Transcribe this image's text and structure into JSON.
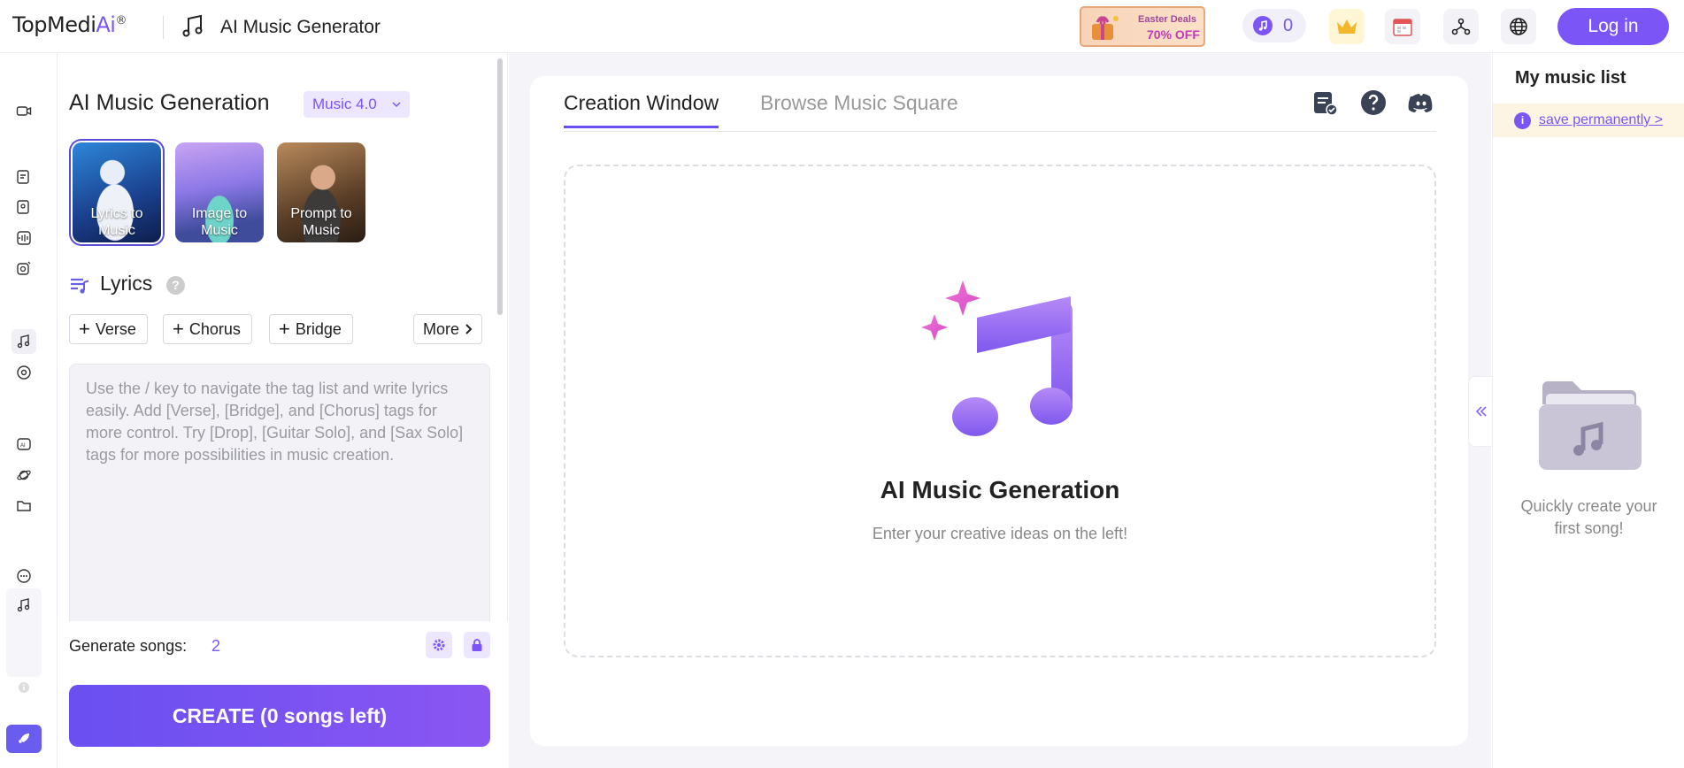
{
  "header": {
    "logo_main": "TopMedi",
    "logo_accent": "Ai",
    "logo_reg": "®",
    "app_title": "AI Music Generator",
    "promo_line1": "Easter Deals",
    "promo_line2": "70% OFF",
    "credits": "0",
    "login_label": "Log in"
  },
  "left_panel": {
    "title": "AI Music Generation",
    "model_badge": "Music 4.0",
    "modes": [
      {
        "label": "Lyrics to Music"
      },
      {
        "label": "Image to Music"
      },
      {
        "label": "Prompt to Music"
      }
    ],
    "lyrics_title": "Lyrics",
    "lyrics_help": "?",
    "tag_buttons": [
      {
        "label": "Verse"
      },
      {
        "label": "Chorus"
      },
      {
        "label": "Bridge"
      }
    ],
    "more_label": "More",
    "lyrics_placeholder": "Use the / key to navigate the tag list and write lyrics easily. Add [Verse], [Bridge], and [Chorus] tags for more control. Try [Drop], [Guitar Solo], and [Sax Solo] tags for more possibilities in music creation.",
    "generate_label": "Generate songs:",
    "generate_value": "2",
    "create_label": "CREATE (0 songs left)"
  },
  "center": {
    "tabs": [
      {
        "label": "Creation Window"
      },
      {
        "label": "Browse Music Square"
      }
    ],
    "empty_title": "AI Music Generation",
    "empty_subtitle": "Enter your creative ideas on the left!"
  },
  "right_panel": {
    "title": "My music list",
    "save_info": "i",
    "save_link": "save permanently >",
    "empty_text": "Quickly create your first song!"
  },
  "colors": {
    "accent": "#7b55f5",
    "create_gradient_start": "#6a4ff1",
    "create_gradient_end": "#8a56f2"
  }
}
